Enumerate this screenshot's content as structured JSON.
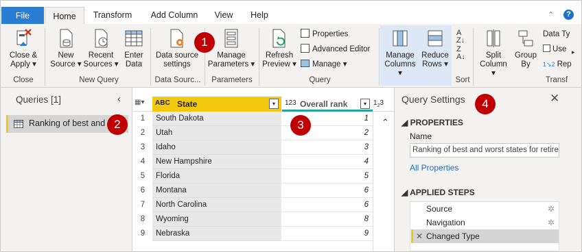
{
  "tabs": {
    "file": "File",
    "home": "Home",
    "transform": "Transform",
    "add_column": "Add Column",
    "view": "View",
    "help": "Help"
  },
  "ribbon": {
    "close_apply": [
      "Close &",
      "Apply"
    ],
    "new_source": [
      "New",
      "Source"
    ],
    "recent_sources": [
      "Recent",
      "Sources"
    ],
    "enter_data": [
      "Enter",
      "Data"
    ],
    "data_source_settings": [
      "Data source",
      "settings"
    ],
    "manage_parameters": [
      "Manage",
      "Parameters"
    ],
    "refresh_preview": [
      "Refresh",
      "Preview"
    ],
    "properties": "Properties",
    "advanced_editor": "Advanced Editor",
    "manage": "Manage",
    "manage_columns": [
      "Manage",
      "Columns"
    ],
    "reduce_rows": [
      "Reduce",
      "Rows"
    ],
    "split_column": [
      "Split",
      "Column"
    ],
    "group_by": [
      "Group",
      "By"
    ],
    "data_type": "Data Ty",
    "use_first_row": "Use",
    "replace_values": "Rep",
    "groups": {
      "close": "Close",
      "new_query": "New Query",
      "data_sources": "Data Sourc...",
      "parameters": "Parameters",
      "query": "Query",
      "sort": "Sort",
      "transform": "Transf"
    }
  },
  "badges": {
    "one": "1",
    "two": "2",
    "three": "3",
    "four": "4"
  },
  "queries": {
    "header": "Queries [1]",
    "item": "Ranking of best and"
  },
  "grid": {
    "col_state": "State",
    "col_rank": "Overall rank",
    "col_state_type": "ABC",
    "col_rank_type": "123",
    "rows": [
      {
        "n": "1",
        "state": "South Dakota",
        "rank": "1"
      },
      {
        "n": "2",
        "state": "Utah",
        "rank": "2"
      },
      {
        "n": "3",
        "state": "Idaho",
        "rank": "3"
      },
      {
        "n": "4",
        "state": "New Hampshire",
        "rank": "4"
      },
      {
        "n": "5",
        "state": "Florida",
        "rank": "5"
      },
      {
        "n": "6",
        "state": "Montana",
        "rank": "6"
      },
      {
        "n": "7",
        "state": "North Carolina",
        "rank": "6"
      },
      {
        "n": "8",
        "state": "Wyoming",
        "rank": "8"
      },
      {
        "n": "9",
        "state": "Nebraska",
        "rank": "9"
      }
    ]
  },
  "settings": {
    "title": "Query Settings",
    "properties": "PROPERTIES",
    "name_label": "Name",
    "name_value": "Ranking of best and worst states for retire",
    "all_properties": "All Properties",
    "applied_steps": "APPLIED STEPS",
    "steps": [
      "Source",
      "Navigation",
      "Changed Type"
    ]
  },
  "colors": {
    "accent": "#2b7cd3",
    "badge": "#c00000",
    "state_header": "#f2c811",
    "rank_underline": "#21a59c"
  }
}
